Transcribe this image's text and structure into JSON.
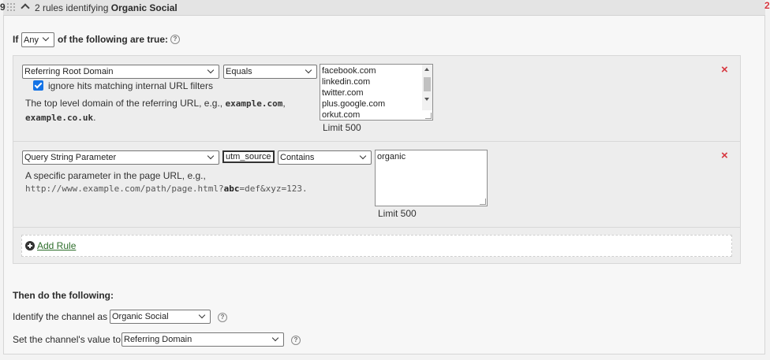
{
  "header": {
    "rule_number": "9",
    "title_prefix": "2 rules identifying",
    "title_channel": "Organic Social",
    "corner_mark": "2"
  },
  "condition": {
    "if_label": "If",
    "match_select": "Any",
    "following_label": "of the following are true:",
    "help_icon": "?"
  },
  "rules": [
    {
      "dimension_select": "Referring Root Domain",
      "operator_select": "Equals",
      "checkbox_checked": true,
      "checkbox_label": "ignore hits matching internal URL filters",
      "description_prefix": "The top level domain of the referring URL, e.g.,",
      "example_1": "example.com",
      "example_sep": ",",
      "example_2": "example.co.uk",
      "example_end": ".",
      "values": [
        "facebook.com",
        "linkedin.com",
        "twitter.com",
        "plus.google.com",
        "orkut.com"
      ],
      "limit": "Limit 500",
      "remove_icon": "×"
    },
    {
      "dimension_select": "Query String Parameter",
      "parameter_value": "utm_source",
      "operator_select": "Contains",
      "description_prefix": "A specific parameter in the page URL, e.g.,",
      "example_url_start": "http://www.example.com/path/page.html?",
      "example_param": "abc",
      "example_url_end": "=def&xyz=123.",
      "values": [
        "organic"
      ],
      "limit": "Limit 500",
      "remove_icon": "×"
    }
  ],
  "add_rule": {
    "label": "Add Rule"
  },
  "then": {
    "heading": "Then do the following:",
    "identify_label": "Identify the channel as",
    "identify_select": "Organic Social",
    "set_label": "Set the channel's value to",
    "set_select": "Referring Domain",
    "help_icon": "?"
  },
  "icons": {
    "grip": "drag-grip-icon",
    "collapse": "chevron-up-icon",
    "help": "help-circle-icon",
    "remove": "close-icon",
    "add": "plus-circle-icon"
  },
  "colors": {
    "accent": "#1473e6",
    "remove": "#d7373f",
    "link": "#2d6e2b"
  }
}
